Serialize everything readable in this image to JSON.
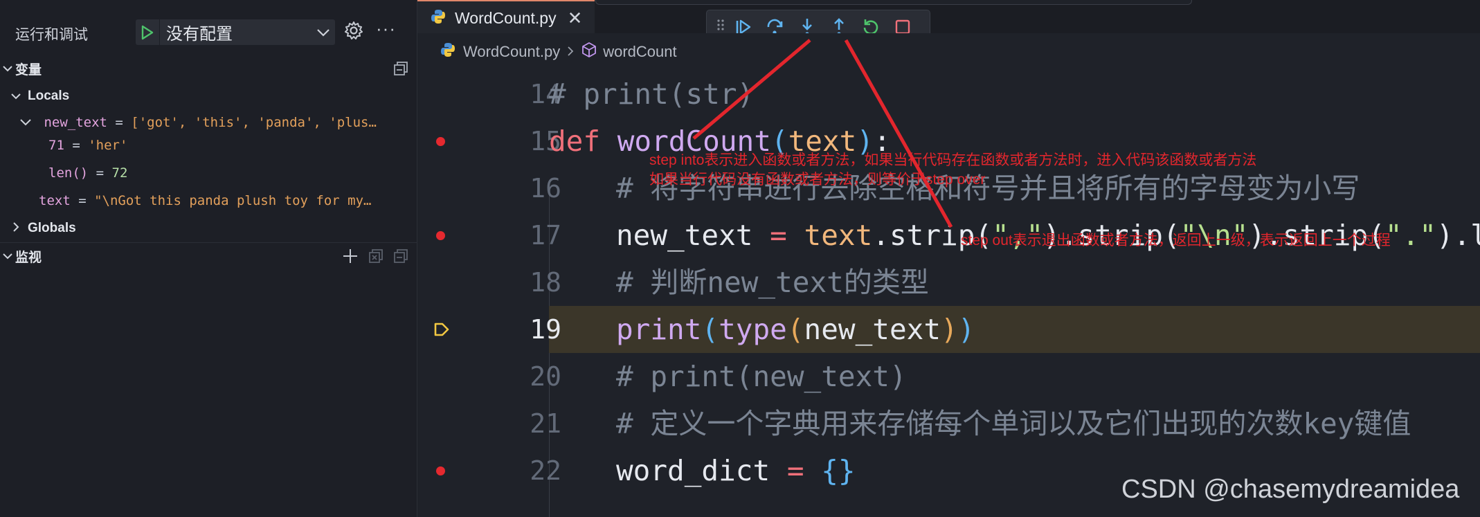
{
  "sidebar": {
    "title": "运行和调试",
    "config_select": "没有配置",
    "sections": {
      "variables": "变量",
      "locals": "Locals",
      "globals": "Globals",
      "watch": "监视"
    },
    "vars": {
      "new_text": {
        "name": "new_text",
        "eq": " = ",
        "value": "['got', 'this', 'panda', 'plus…"
      },
      "idx71": {
        "name": "71",
        "eq": " = ",
        "value": "'her'"
      },
      "len": {
        "name": "len()",
        "eq": " = ",
        "value": "72"
      },
      "text": {
        "name": "text",
        "eq": " = ",
        "value": "\"\\nGot this panda plush toy for my…"
      }
    }
  },
  "editor": {
    "tab_label": "WordCount.py",
    "tab_close": "✕",
    "breadcrumb": {
      "file": "WordCount.py",
      "symbol": "wordCount"
    },
    "lines": [
      {
        "num": "14",
        "breakpoint": false,
        "current": false
      },
      {
        "num": "15",
        "breakpoint": true,
        "current": false
      },
      {
        "num": "16",
        "breakpoint": false,
        "current": false
      },
      {
        "num": "17",
        "breakpoint": true,
        "current": false
      },
      {
        "num": "18",
        "breakpoint": false,
        "current": false
      },
      {
        "num": "19",
        "breakpoint": false,
        "current": true
      },
      {
        "num": "20",
        "breakpoint": false,
        "current": false
      },
      {
        "num": "21",
        "breakpoint": false,
        "current": false
      },
      {
        "num": "22",
        "breakpoint": true,
        "current": false
      }
    ],
    "code": {
      "l14": "# print(str)",
      "l15_kw": "def",
      "l15_fn": "wordCount",
      "l15_param": "text",
      "l16": "# 将字符串进行去除空格和符号并且将所有的字母变为小写",
      "l17_a": "new_text",
      "l17_b": "text",
      "l17_c": ".strip(",
      "l17_s1": "\",\"",
      "l17_d": ").strip(",
      "l17_s2": "\"\\n\"",
      "l17_e": ").strip(",
      "l17_s3": "\".\"",
      "l17_f": ").l",
      "l18": "# 判断new_text的类型",
      "l19_print": "print",
      "l19_type": "type",
      "l19_arg": "new_text",
      "l20": "# print(new_text)",
      "l21": "# 定义一个字典用来存储每个单词以及它们出现的次数key键值",
      "l22_a": "word_dict",
      "l22_b": "{}"
    }
  },
  "annotations": {
    "step_into_1": "step into表示进入函数或者方法，如果当行代码存在函数或者方法时，进入代码该函数或者方法",
    "step_into_2": "如果当行代码没有函数或者方法，则等价于step over",
    "step_out": "step out表示退出函数或者方法，返回上一级，表示返回上一个过程",
    "arrow_color": "#e3262d"
  },
  "watermark": "CSDN @chasemydreamidea",
  "colors": {
    "breakpoint": "#e5292f",
    "current_line_arrow": "#f2c842",
    "debug_blue": "#5fb4f0",
    "debug_green": "#4ec36b",
    "stop_red": "#f0707a"
  }
}
